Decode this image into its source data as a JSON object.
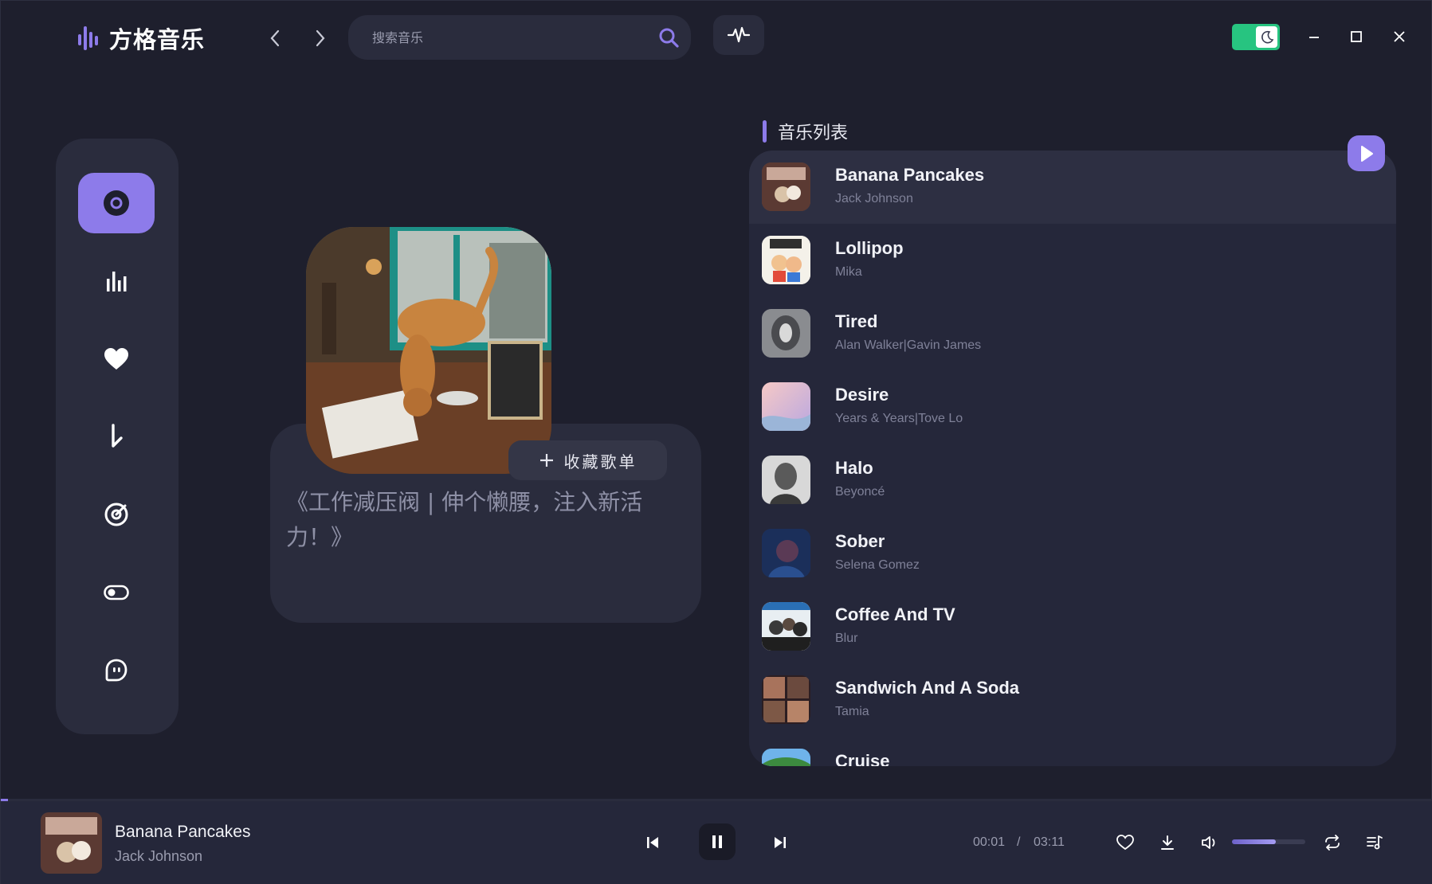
{
  "app": {
    "name": "方格音乐"
  },
  "search": {
    "placeholder": "搜索音乐"
  },
  "sidebar": {
    "items": [
      {
        "icon": "disc-icon",
        "active": true
      },
      {
        "icon": "bar-chart-icon",
        "active": false
      },
      {
        "icon": "heart-icon",
        "active": false
      },
      {
        "icon": "download-arrow-icon",
        "active": false
      },
      {
        "icon": "target-icon",
        "active": false
      },
      {
        "icon": "toggle-icon",
        "active": false
      },
      {
        "icon": "chat-bubble-icon",
        "active": false
      }
    ]
  },
  "playlist": {
    "collect_label": "收藏歌单",
    "description": "《工作减压阀 | 伸个懒腰，注入新活力！》"
  },
  "music_list": {
    "heading": "音乐列表",
    "songs": [
      {
        "title": "Banana Pancakes",
        "artist": "Jack Johnson",
        "thumb_color": "#7a4a3a"
      },
      {
        "title": "Lollipop",
        "artist": "Mika",
        "thumb_color": "#f2eee6"
      },
      {
        "title": "Tired",
        "artist": "Alan Walker|Gavin James",
        "thumb_color": "#6b6d72"
      },
      {
        "title": "Desire",
        "artist": "Years & Years|Tove Lo",
        "thumb_color": "#e8a7b2"
      },
      {
        "title": "Halo",
        "artist": "Beyoncé",
        "thumb_color": "#3a3a3c"
      },
      {
        "title": "Sober",
        "artist": "Selena Gomez",
        "thumb_color": "#1f3a6b"
      },
      {
        "title": "Coffee And TV",
        "artist": "Blur",
        "thumb_color": "#cfd6dc"
      },
      {
        "title": "Sandwich And A Soda",
        "artist": "Tamia",
        "thumb_color": "#3a2530"
      },
      {
        "title": "Cruise",
        "artist": "",
        "thumb_color": "#3f86c8"
      }
    ]
  },
  "player": {
    "title": "Banana Pancakes",
    "artist": "Jack Johnson",
    "current_time": "00:01",
    "separator": "/",
    "total_time": "03:11",
    "progress": 0.005,
    "volume": 0.6
  },
  "colors": {
    "accent": "#8d7bea",
    "toggle": "#27c480"
  }
}
